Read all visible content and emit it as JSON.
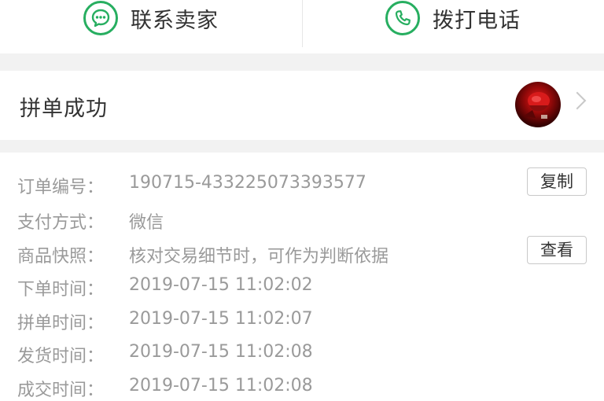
{
  "actions": {
    "contact_seller": "联系卖家",
    "call": "拨打电话"
  },
  "colors": {
    "accent_green": "#27ae60"
  },
  "status": {
    "label": "拼单成功"
  },
  "order": {
    "number": {
      "key": "订单编号：",
      "value": "190715-433225073393577",
      "button": "复制"
    },
    "payment": {
      "key": "支付方式：",
      "value": "微信"
    },
    "snapshot": {
      "key": "商品快照：",
      "value": "核对交易细节时，可作为判断依据",
      "button": "查看"
    },
    "order_time": {
      "key": "下单时间：",
      "value": "2019-07-15 11:02:02"
    },
    "group_time": {
      "key": "拼单时间：",
      "value": "2019-07-15 11:02:07"
    },
    "ship_time": {
      "key": "发货时间：",
      "value": "2019-07-15 11:02:08"
    },
    "deal_time": {
      "key": "成交时间：",
      "value": "2019-07-15 11:02:08"
    }
  }
}
